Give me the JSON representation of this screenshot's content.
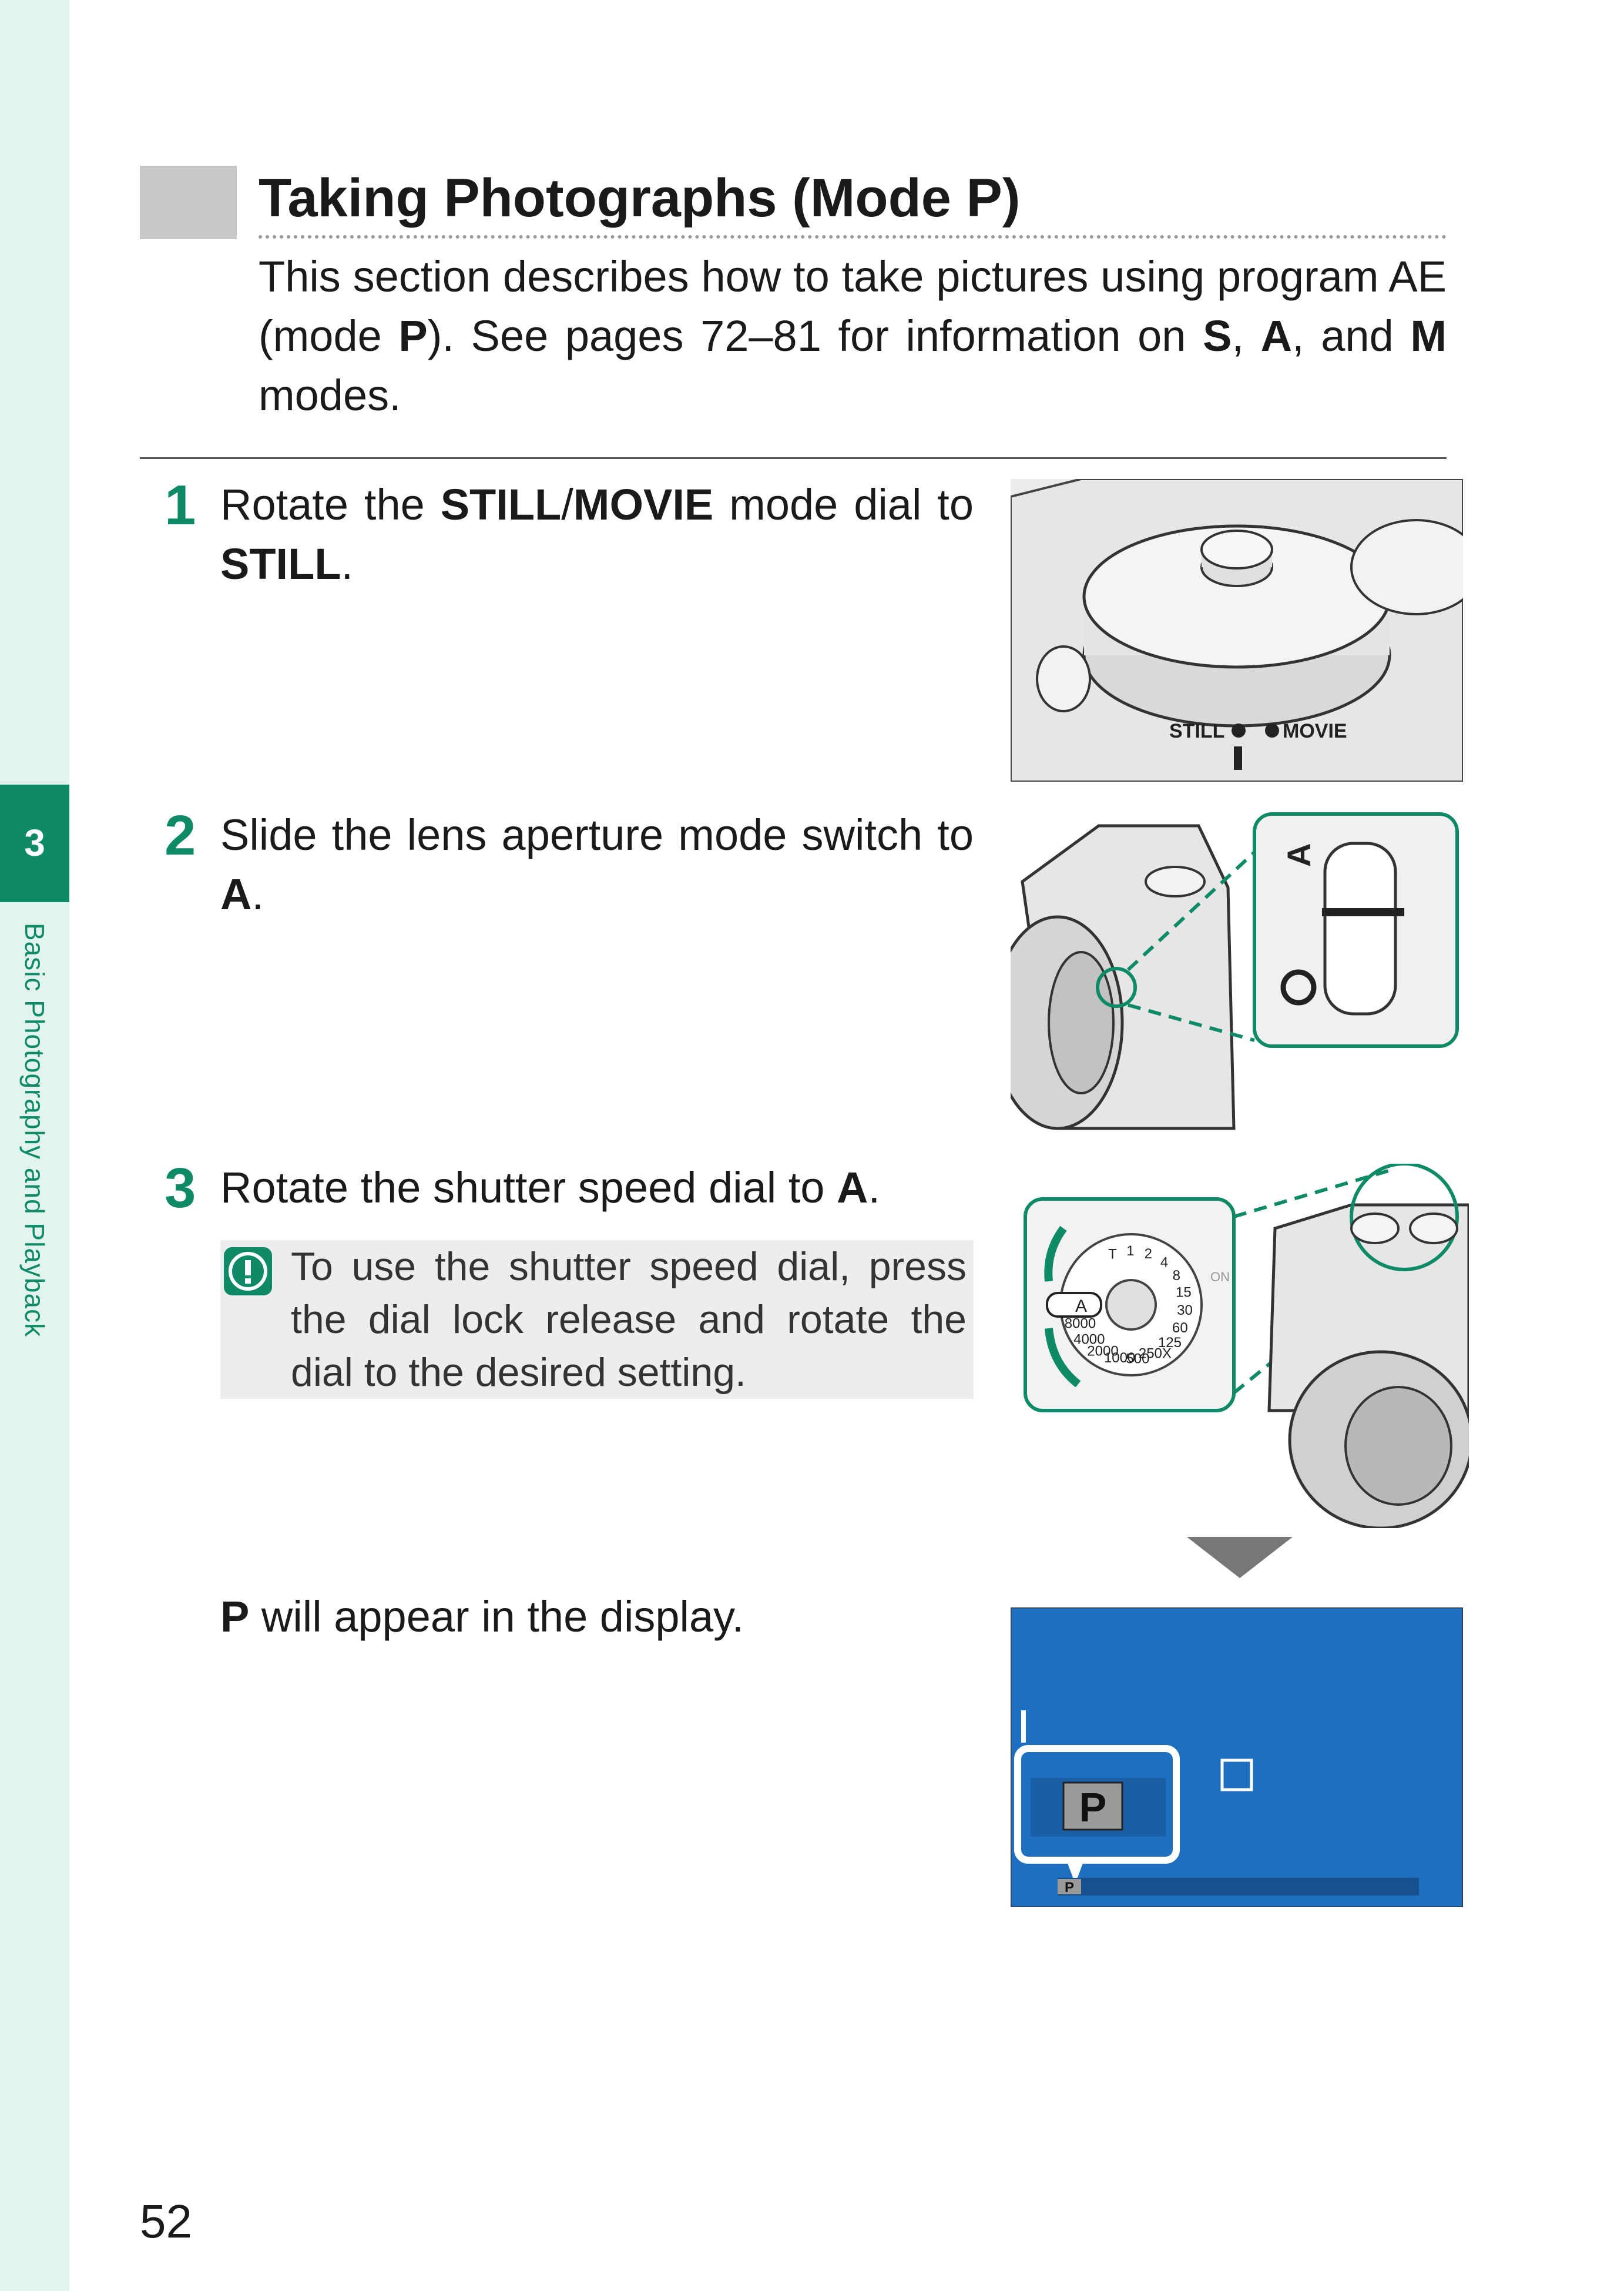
{
  "sidebar": {
    "chapter_number": "3",
    "chapter_label": "Basic Photography and Playback"
  },
  "header": {
    "title": "Taking Photographs (Mode P)"
  },
  "intro": {
    "text_1": "This section describes how to take pictures using program AE (mode ",
    "mode_p": "P",
    "text_2": "). See pages 72–81 for information on ",
    "mode_s": "S",
    "sep_1": ", ",
    "mode_a": "A",
    "sep_2": ", and ",
    "mode_m": "M",
    "text_3": " modes."
  },
  "steps": [
    {
      "number": "1",
      "text_1": "Rotate the ",
      "bold_1": "STILL",
      "sep": "/",
      "bold_2": "MOVIE",
      "text_2": " mode dial to ",
      "bold_3": "STILL",
      "text_3": "."
    },
    {
      "number": "2",
      "text_1": "Slide the lens aperture mode switch to ",
      "bold_1": "A",
      "text_2": "."
    },
    {
      "number": "3",
      "text_1": "Rotate the shutter speed dial to ",
      "bold_1": "A",
      "text_2": "."
    }
  ],
  "note": {
    "text": "To use the shutter speed dial, press the dial lock release and rotate the dial to the desired setting."
  },
  "result": {
    "bold": "P",
    "text": " will appear in the display."
  },
  "illustrations": {
    "dial_still": "STILL",
    "dial_movie": "MOVIE",
    "switch_a": "A",
    "shutter_a": "A",
    "shutter_values": [
      "T",
      "1",
      "2",
      "4",
      "8",
      "15",
      "30",
      "60",
      "125",
      "250X",
      "500",
      "1000",
      "2000",
      "4000",
      "8000"
    ],
    "shutter_on": "ON",
    "display_p": "P",
    "display_p_small": "P"
  },
  "page": {
    "number": "52"
  },
  "colors": {
    "accent": "#0e8a66",
    "sidebar_bg": "#e3f4ee",
    "display_blue": "#1e6fbf"
  }
}
